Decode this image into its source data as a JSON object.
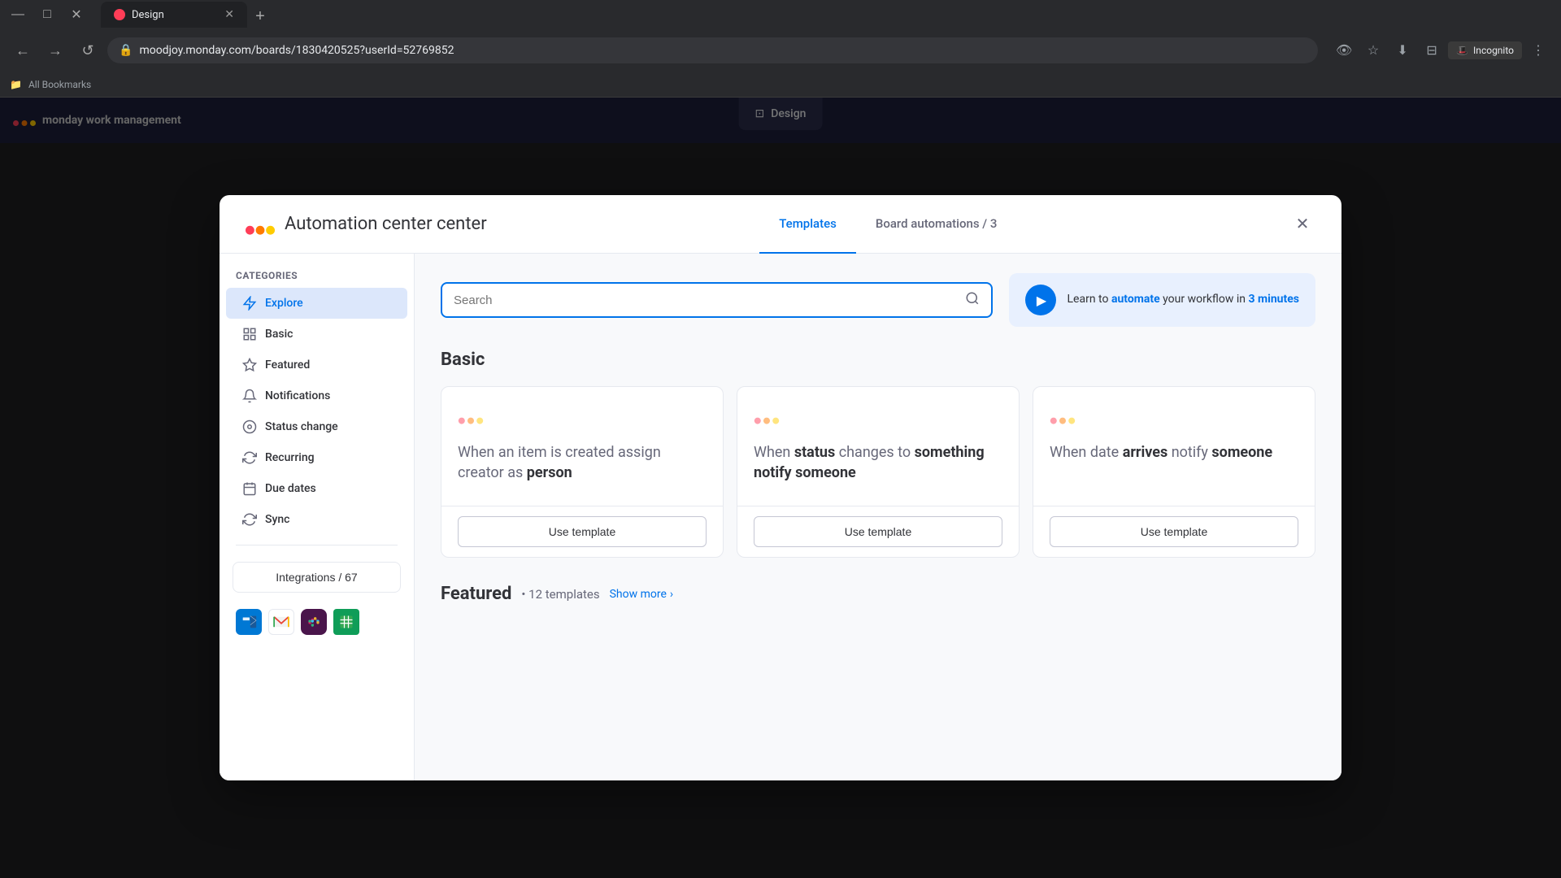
{
  "browser": {
    "url": "moodjoy.monday.com/boards/1830420525?userId=52769852",
    "tab_title": "Design",
    "incognito_label": "Incognito",
    "bookmarks_label": "All Bookmarks",
    "new_tab_symbol": "+"
  },
  "design_tab": {
    "label": "Design"
  },
  "modal": {
    "title_part1": "Automation",
    "title_part2": "center",
    "close_symbol": "✕",
    "tabs": [
      {
        "label": "Templates",
        "active": true
      },
      {
        "label": "Board automations / 3",
        "active": false
      }
    ],
    "search": {
      "placeholder": "Search"
    },
    "video_banner": {
      "text_before": "Learn to ",
      "text_bold": "automate",
      "text_after": " your workflow in ",
      "minutes": "3 minutes"
    },
    "sidebar": {
      "section_title": "Categories",
      "items": [
        {
          "id": "explore",
          "label": "Explore",
          "icon": "⚡",
          "active": true
        },
        {
          "id": "basic",
          "label": "Basic",
          "icon": "⊞"
        },
        {
          "id": "featured",
          "label": "Featured",
          "icon": "★"
        },
        {
          "id": "notifications",
          "label": "Notifications",
          "icon": "🔔"
        },
        {
          "id": "status-change",
          "label": "Status change",
          "icon": "◎"
        },
        {
          "id": "recurring",
          "label": "Recurring",
          "icon": "↻"
        },
        {
          "id": "due-dates",
          "label": "Due dates",
          "icon": "📅"
        },
        {
          "id": "sync",
          "label": "Sync",
          "icon": "⟳"
        }
      ],
      "integrations_btn": "Integrations / 67",
      "integration_icons": [
        "📧",
        "✉",
        "💬",
        "📋"
      ]
    },
    "basic_section": {
      "title": "Basic",
      "cards": [
        {
          "text_before": "When an item is created assign creator as ",
          "text_bold": "person",
          "btn_label": "Use template"
        },
        {
          "text_before": "When ",
          "text_bold1": "status",
          "text_middle": " changes to ",
          "text_bold2": "something notify someone",
          "btn_label": "Use template"
        },
        {
          "text_before": "When date ",
          "text_bold1": "arrives",
          "text_middle": " notify ",
          "text_bold2": "someone",
          "btn_label": "Use template"
        }
      ]
    },
    "featured_section": {
      "title": "Featured",
      "count_label": "• 12 templates",
      "show_more": "Show more",
      "show_more_arrow": "›"
    }
  }
}
